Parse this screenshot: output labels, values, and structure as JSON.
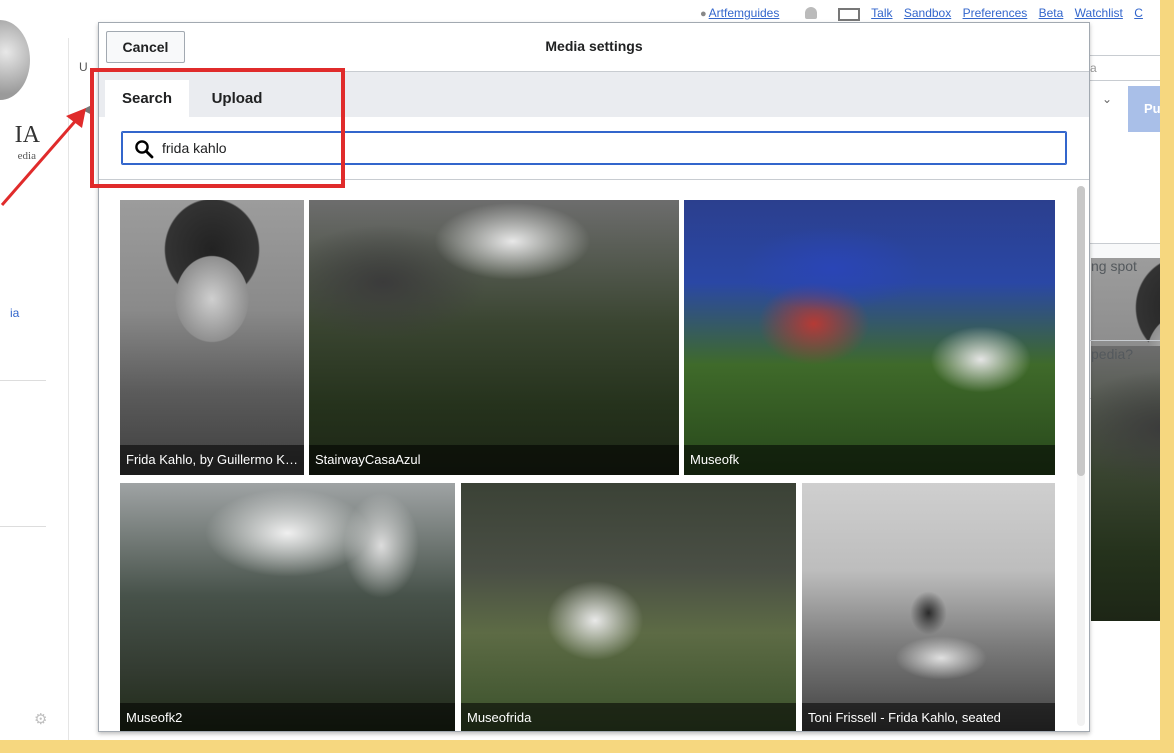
{
  "topbar": {
    "username": "Artfemguides",
    "links": [
      "Talk",
      "Sandbox",
      "Preferences",
      "Beta",
      "Watchlist",
      "C"
    ]
  },
  "background": {
    "logo_word": "IA",
    "logo_tag": "edia",
    "left_link": "ia",
    "top_left_text": "U",
    "search_placeholder": "a",
    "publish_label": "Pub",
    "box_text_1": "ng spot",
    "box_text_2": "pedia?"
  },
  "dialog": {
    "title": "Media settings",
    "cancel_label": "Cancel",
    "tabs": [
      {
        "label": "Search",
        "active": true
      },
      {
        "label": "Upload",
        "active": false
      }
    ],
    "search": {
      "value": "frida kahlo",
      "icon": "search-icon"
    },
    "results": [
      {
        "caption": "Frida Kahlo, by Guillermo Kahlo"
      },
      {
        "caption": "StairwayCasaAzul"
      },
      {
        "caption": "Museofk"
      },
      {
        "caption": "Museofk2"
      },
      {
        "caption": "Museofrida"
      },
      {
        "caption": "Toni Frissell - Frida Kahlo, seated"
      }
    ]
  },
  "annotation": {
    "color": "#e02b2b"
  }
}
